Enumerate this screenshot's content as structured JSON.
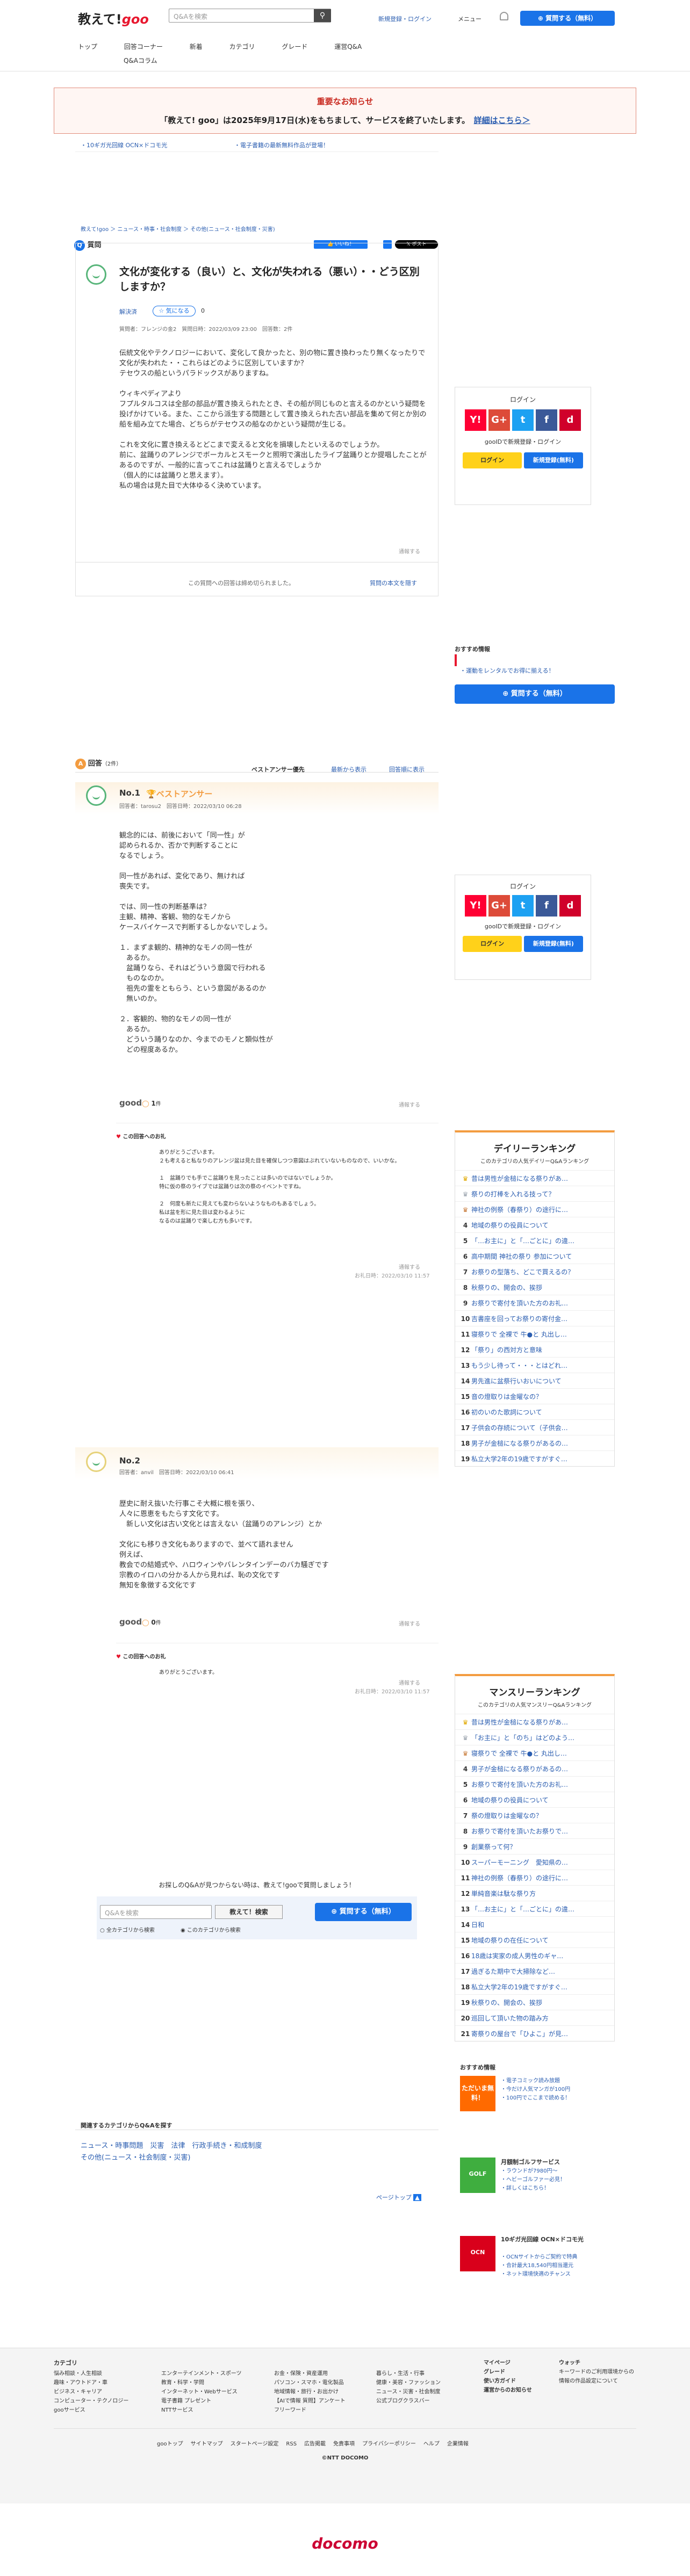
{
  "header": {
    "logo_main": "教えて!",
    "logo_goo": "goo",
    "search_placeholder": "Q&Aを検索",
    "register_login": "新規登録・ログイン",
    "menu": "メニュー",
    "ask_button": "質問する（無料）"
  },
  "gnav": [
    "トップ",
    "回答コーナー",
    "新着",
    "カテゴリ",
    "グレード",
    "運営Q&A"
  ],
  "gnav2": "Q&Aコラム",
  "notice": {
    "title": "重要なお知らせ",
    "text": "「教えて! goo」は2025年9月17日(水)をもちまして、サービスを終了いたします。",
    "link": "詳細はこちら＞"
  },
  "promos": [
    "10ギガ光回線 OCN×ドコモ光",
    "電子書籍の最新無料作品が登場！"
  ],
  "breadcrumb": "教えて!goo ＞ ニュース・時事・社会制度 ＞ その他(ニュース・社会制度・災害)",
  "question": {
    "label": "質問",
    "title": "文化が変化する（良い）と、文化が失われる（悪い）・・どう区別しますか？",
    "status": "解決済",
    "thanks": "気になる",
    "thanks_count": "0",
    "meta": "質問者：フレンジの金2　質問日時：2022/03/09 23:00　回答数：2件",
    "body": "伝統文化やテクノロジーにおいて、変化して良かったと、別の物に置き換わったり無くなったりで文化が失われた・・これらはどのように区別していますか？\nテセウスの船というパラドックスがありますね。\n\nウィキペディアより\nフプルタルコスは全部の部品が置き換えられたとき、その船が同じものと言えるのかという疑問を投げかけている。また、ここから派生する問題として置き換えられた古い部品を集めて何とか別の船を組み立てた場合、どちらがテセウスの船なのかという疑問が生じる。\n\nこれを文化に置き換えるとどこまで変えると文化を損壊したといえるのでしょうか。\n前に、盆踊りのアレンジでボーカルとスモークと照明で演出したライブ盆踊りとか提唱したことがあるのですが、一般的に言ってこれは盆踊りと言えるでしょうか\n（個人的には盆踊りと思えます）。\n私の場合は見た目で大体ゆるく決めています。",
    "report": "通報する",
    "closed": "この質問への回答は締め切られました。",
    "closed_link": "質問の本文を隠す",
    "share_like": "いいね！",
    "share_x": "ポスト"
  },
  "login": {
    "title": "ログイン",
    "desc": "gooIDで新規登録・ログイン",
    "login_btn": "ログイン",
    "register_btn": "新規登録(無料)"
  },
  "recommend": {
    "title": "おすすめ情報",
    "link": "・運動をレンタルでお得に揃える！",
    "ask": "質問する（無料）"
  },
  "answers_head": {
    "label": "回答",
    "count": "（2件）",
    "sort": [
      "ベストアンサー優先",
      "最新から表示",
      "回答順に表示"
    ]
  },
  "answers": [
    {
      "no": "No.1",
      "best": "ベストアンサー",
      "meta": "回答者：tarosu2　回答日時：2022/03/10 06:28",
      "body": "観念的には、前後において「同一性」が\n認められるか、否かで判断することに\nなるでしょう。\n\n同一性があれば、変化であり、無ければ\n喪失です。\n\nでは、同一性の判断基準は？\n主観、精神、客観、物的なモノから\nケースバイケースで判断するしかないでしょう。\n\n１．まずま観的、精神的なモノの同一性が\n　あるか。\n　盆踊りなら、それはどういう意図で行われる\n　ものなのか。\n　祖先の霊をともらう、という意図があるのか\n　無いのか。\n\n２．客観的、物的なモノの同一性が\n　あるか。\n　どういう踊りなのか、今までのモノと類似性が\n　どの程度あるか。",
      "good": "1",
      "report": "通報する",
      "reply_label": "この回答へのお礼",
      "reply": "ありがとうございます。\n２も考えると私なりのアレンジ盆は見た目を確保しつつ意図はぶれていないものなので、いいかな。\n\n１　盆踊りでも手でこ盆踊りを見ったことは多いのではないでしょうか。\n特に仮の祭のライブでは盆踊りは次の祭のイベントですね。\n\n２　何度も新たに見えても変わらないようなものもあるでしょう。\n私は盆を形に見た目は変わるように\nなるのは盆踊りで楽しむ方も多いです。",
      "reply_meta": "通報する",
      "reply_date": "お礼日時：2022/03/10 11:57"
    },
    {
      "no": "No.2",
      "meta": "回答者：anvil　回答日時：2022/03/10 06:41",
      "body": "歴史に耐え抜いた行事こそ大概に根を張り、\n人々に恩恵をもたらす文化です。\n　新しい文化は古い文化とは言えない（盆踊りのアレンジ）とか\n\n文化にも移りき文化もありますので、並べて語れません\n例えば、\n教会での結婚式や、ハロウィンやバレンタインデーのバカ騒ぎです\n宗教のイロハの分かる人から見れば、恥の文化です\n無知を象徴する文化です",
      "good": "0",
      "report": "通報する",
      "reply_label": "この回答へのお礼",
      "reply": "ありがとうございます。",
      "reply_meta": "通報する",
      "reply_date": "お礼日時：2022/03/10 11:57"
    }
  ],
  "bottom_search": {
    "lead": "お探しのQ&Aが見つからない時は、教えて!gooで質問しましょう！",
    "placeholder": "Q&Aを検索",
    "btn": "教えて！検索",
    "ask": "質問する（無料）",
    "opt_all": "全カテゴリから検索",
    "opt_cat": "このカテゴリから検索"
  },
  "related": {
    "title": "関連するカテゴリからQ&Aを探す",
    "links": [
      "ニュース・時事問題",
      "災害",
      "法律",
      "行政手続き・和成制度",
      "その他(ニュース・社会制度・災害)"
    ]
  },
  "pagetop": "ページトップ",
  "daily": {
    "title": "デイリーランキング",
    "sub": "このカテゴリの人気デイリーQ&Aランキング",
    "items": [
      "昔は男性が金槌になる祭りがあ…",
      "祭りの打棒を入れる技って？",
      "神社の例祭（春祭り）の途行に…",
      "地域の祭りの役員について",
      "「…お主に」と「…ごとに」の違…",
      "高中期間 神社の祭り 参加について",
      "お祭りの型落ち、どこで買えるの？",
      "秋祭りの、開会の、挨拶",
      "お祭りで寄付を頂いた方のお礼…",
      "吉書座を回ってお祭りの寄付金…",
      "寝祭りで 全裸で 牛●と 丸出し…",
      "「祭り」の西対方と意味",
      "もう少し待って・・・とはどれ…",
      "男先進に盆祭行いおいについて",
      "音の燈取りは金曜なの？",
      "初のいのた歌詞について",
      "子供会の存続について（子供会…",
      "男子が金槌になる祭りがあるの…",
      "私立大学2年の19歳ですがすぐ…"
    ]
  },
  "monthly": {
    "title": "マンスリーランキング",
    "sub": "このカテゴリの人気マンスリーQ&Aランキング",
    "items": [
      "昔は男性が金槌になる祭りがあ…",
      "「お主に」と「のち」はどのよう…",
      "寝祭りで 全裸で 牛●と 丸出し…",
      "男子が金槌になる祭りがあるの…",
      "お祭りで寄付を頂いた方のお礼…",
      "地域の祭りの役員について",
      "祭の燈取りは金曜なの？",
      "お祭りで寄付を頂いたお祭りで…",
      "創業祭って何？",
      "スーパーモーニング　愛知県の…",
      "神社の例祭（春祭り）の途行に…",
      "単純音楽は駄な祭り方",
      "「…お主に」と「…ごとに」の違…",
      "日和",
      "地域の祭りの在任について",
      "18歳は実家の成人男性のギャ…",
      "過ぎるた期中で大掃除など…",
      "私立大学2年の19歳ですがすぐ…",
      "秋祭りの、開会の、挨拶",
      "巡回して頂いた物の踏み方",
      "寄祭りの屋台で「ひよこ」が見…"
    ]
  },
  "side_promo": {
    "title": "おすすめ情報",
    "p1_title": "ただいま無料！",
    "p1_items": [
      "・電子コミック読み放題",
      "・今だけ人気マンガが100円",
      "・100円でここまで読める！"
    ],
    "p2_title": "月額制ゴルフサービス",
    "p2_items": [
      "・ラウンドが7980円～",
      "・ヘビーゴルファー必見！",
      "・詳しくはこちら！"
    ],
    "p3_title": "10ギガ光回線 OCN×ドコモ光",
    "p3_items": [
      "・OCNサイトからご契約で特典",
      "・合計最大18,540円相当還元",
      "・ネット環境快適のチャンス"
    ]
  },
  "footer": {
    "cat_title": "カテゴリ",
    "col1": [
      "悩み相談・人生相談",
      "趣味・アウトドア・車",
      "ビジネス・キャリア",
      "コンピューター・テクノロジー",
      "gooサービス"
    ],
    "col2": [
      "エンターテインメント・スポーツ",
      "教育・科学・学問",
      "インターネット・Webサービス",
      "電子書籍 プレゼント",
      "NTTサービス"
    ],
    "col3": [
      "お金・保険・資産運用",
      "パソコン・スマホ・電化製品",
      "地域情報・旅行・お出かけ",
      "【AIで情報 質問】アンケート",
      "フリーワード"
    ],
    "col4": [
      "暮らし・生活・行事",
      "健康・美容・ファッション",
      "ニュース・災害・社会制度",
      "公式ブログクラスバー"
    ],
    "col5_title": "マイページ",
    "col5": [
      "グレード",
      "使い方ガイド",
      "運営からのお知らせ"
    ],
    "col6_title": "ウォッチ",
    "col6": "キーワードのご利用環境からの情報の作品設定について",
    "links": [
      "gooトップ",
      "サイトマップ",
      "スタートページ設定",
      "RSS",
      "広告掲載",
      "免責事項",
      "プライバシーポリシー",
      "ヘルプ",
      "企業情報"
    ],
    "copyright": "©NTT DOCOMO",
    "docomo": "docomo"
  },
  "colors": {
    "accent": "#1a73e8",
    "brand_red": "#e8182f",
    "best_orange": "#f39c40",
    "avatar_green": "#58b57a",
    "yellow": "#ffd11a"
  }
}
